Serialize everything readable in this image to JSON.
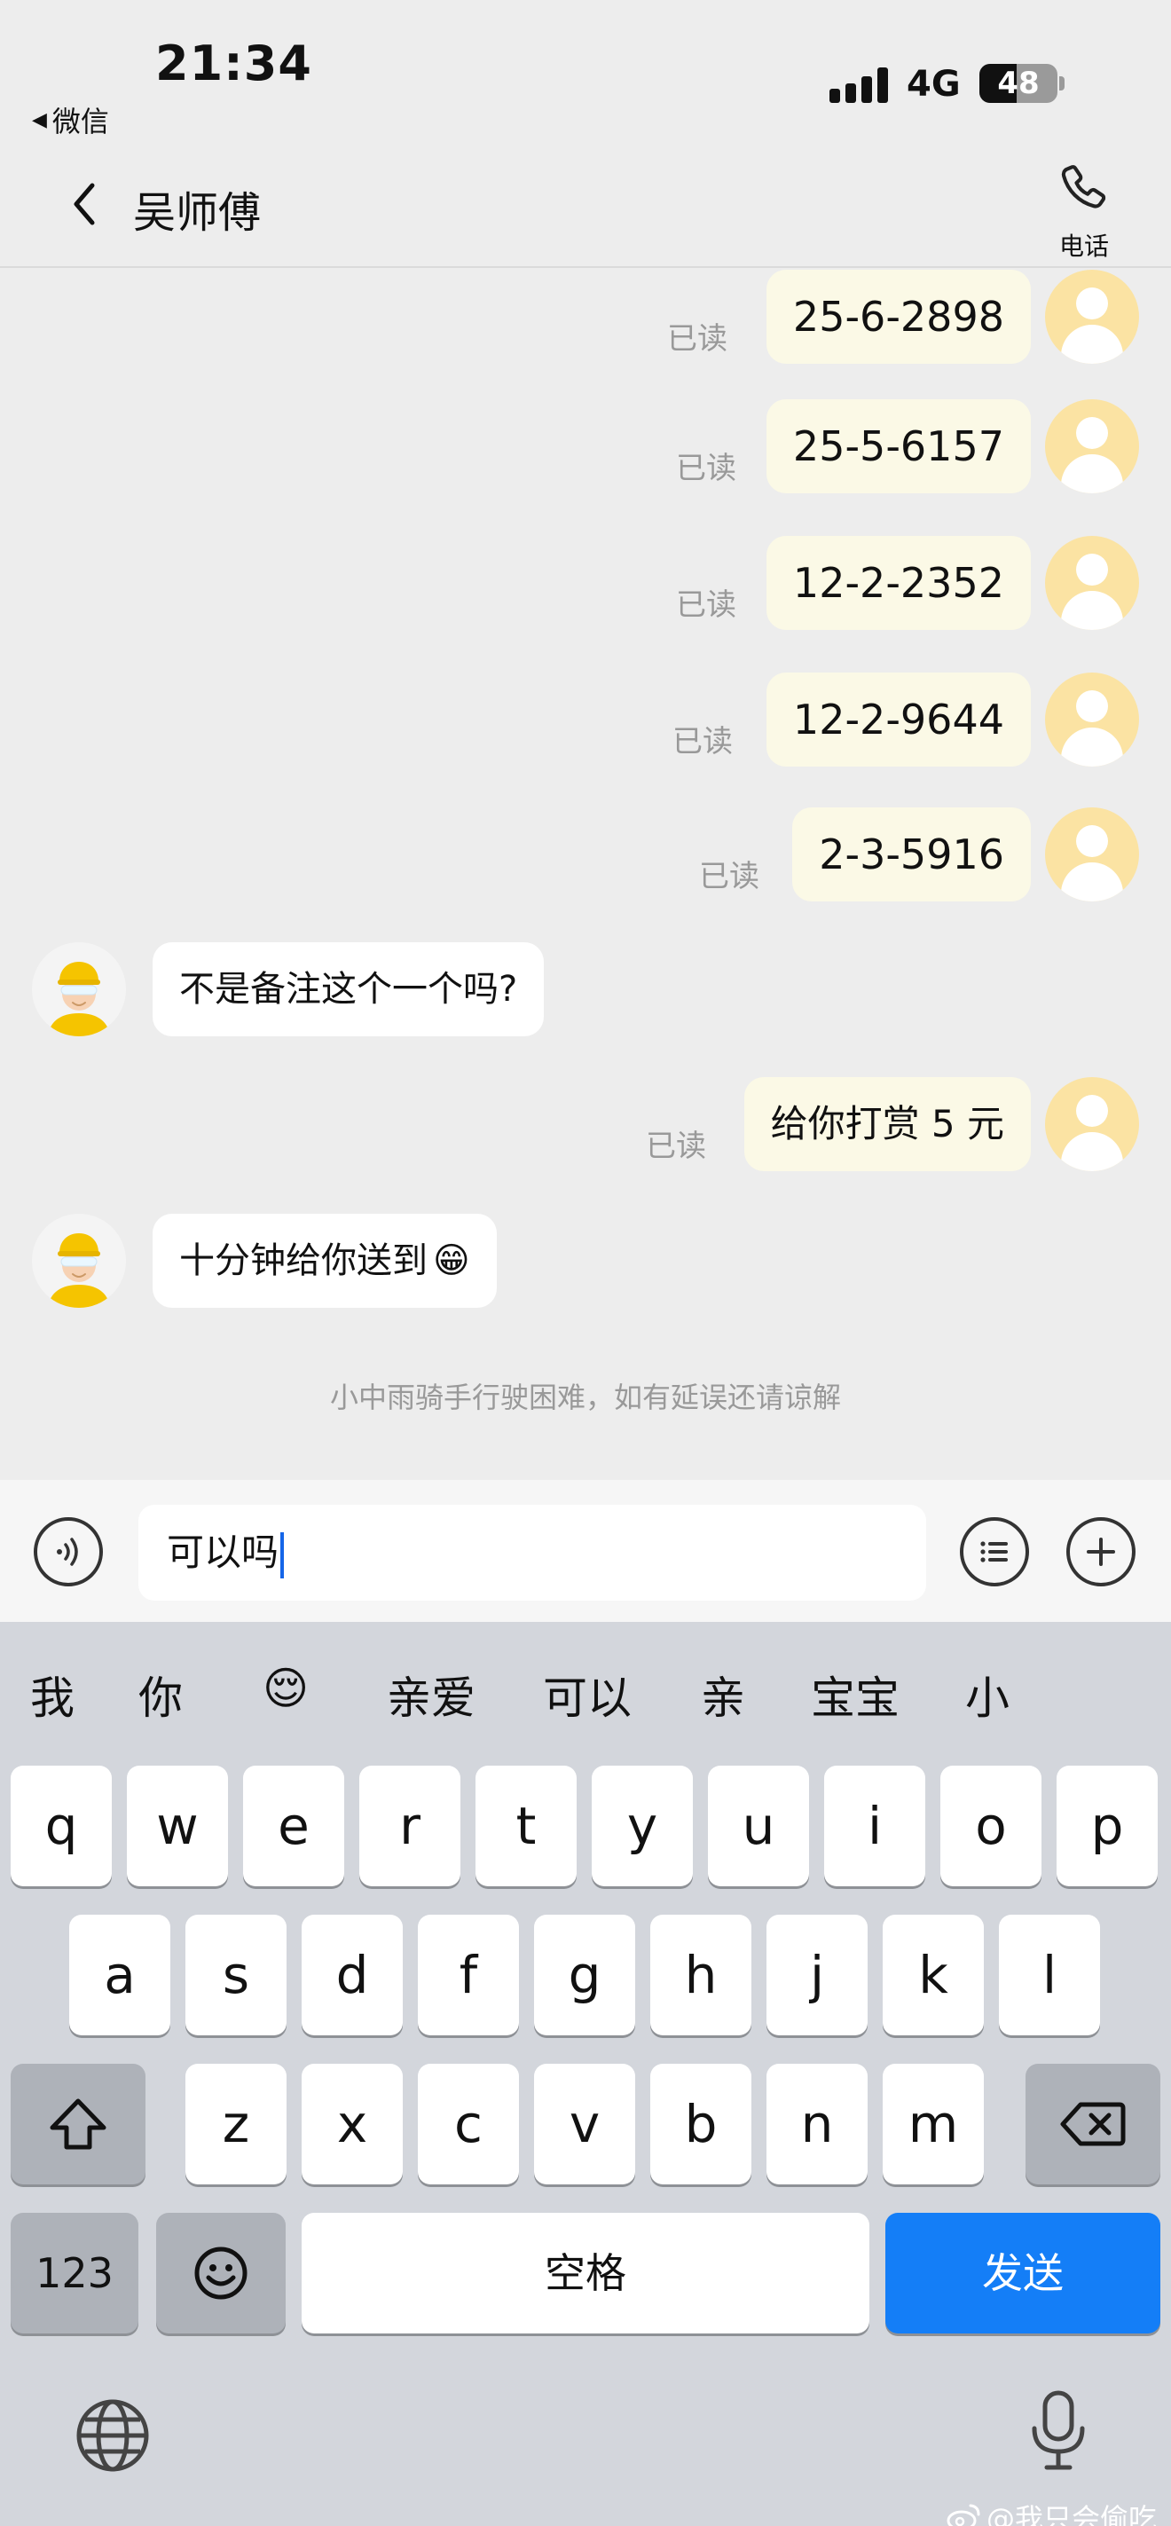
{
  "status_bar": {
    "time": "21:34",
    "back_app": "微信",
    "network": "4G",
    "battery": "48",
    "battery_level": 0.48
  },
  "nav": {
    "title": "吴师傅",
    "call_label": "电话"
  },
  "messages": [
    {
      "side": "me",
      "text": "25-6-2898",
      "read": "已读"
    },
    {
      "side": "me",
      "text": "25-5-6157",
      "read": "已读"
    },
    {
      "side": "me",
      "text": "12-2-2352",
      "read": "已读"
    },
    {
      "side": "me",
      "text": "12-2-9644",
      "read": "已读"
    },
    {
      "side": "me",
      "text": "2-3-5916",
      "read": "已读"
    },
    {
      "side": "them",
      "text": "不是备注这个一个吗?"
    },
    {
      "side": "me",
      "text": "给你打赏 5 元",
      "read": "已读"
    },
    {
      "side": "them",
      "text": "十分钟给你送到",
      "emoji": "😁"
    }
  ],
  "notice": "小中雨骑手行驶困难，如有延误还请谅解",
  "input": {
    "value": "可以吗"
  },
  "keyboard": {
    "candidates": [
      "我",
      "你",
      "😌",
      "亲爱",
      "可以",
      "亲",
      "宝宝",
      "小"
    ],
    "row1": [
      "q",
      "w",
      "e",
      "r",
      "t",
      "y",
      "u",
      "i",
      "o",
      "p"
    ],
    "row2": [
      "a",
      "s",
      "d",
      "f",
      "g",
      "h",
      "j",
      "k",
      "l"
    ],
    "row3": [
      "z",
      "x",
      "c",
      "v",
      "b",
      "n",
      "m"
    ],
    "num_label": "123",
    "space_label": "空格",
    "send_label": "发送"
  },
  "watermark": "@我只会偷吃",
  "colors": {
    "send_button": "#147ef7",
    "my_bubble": "#fbf9e6",
    "my_avatar": "#fbe3a3",
    "caret": "#1565e8"
  }
}
